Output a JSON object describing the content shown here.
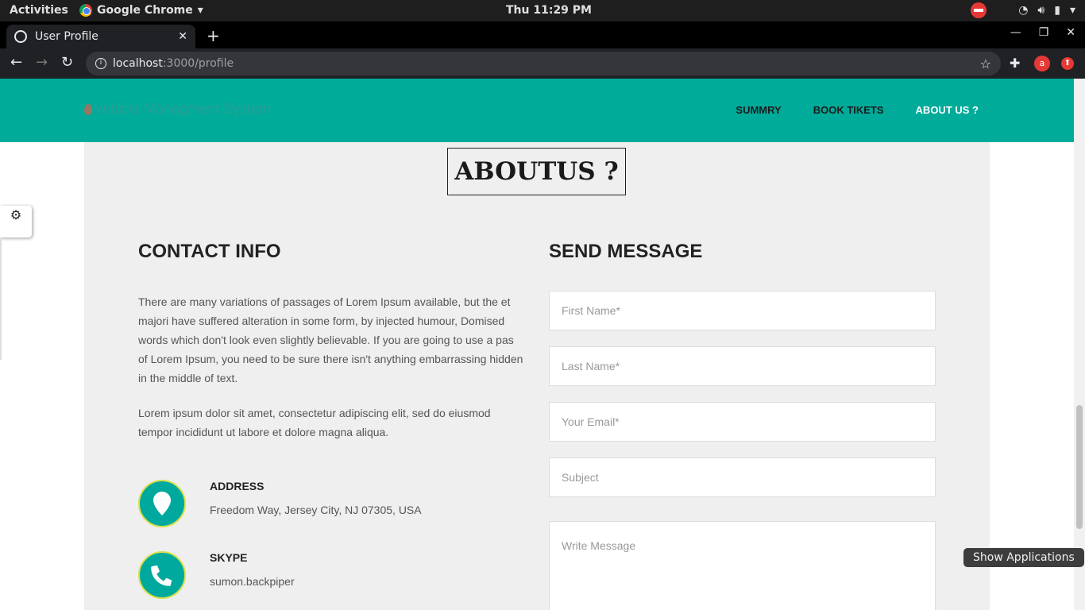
{
  "os_bar": {
    "activities": "Activities",
    "app_name": "Google Chrome",
    "clock": "Thu 11:29 PM"
  },
  "browser": {
    "tab_title": "User Profile",
    "url_host": "localhost",
    "url_path": ":3000/profile",
    "ext_avatar_letter": "a"
  },
  "navbar": {
    "brand": "Vehicle Managment System",
    "links": [
      {
        "label": "SUMMRY"
      },
      {
        "label": "BOOK TIKETS"
      },
      {
        "label": "ABOUT US ?"
      }
    ],
    "bg_color": "#00ab9a"
  },
  "about": {
    "title": "ABOUTUS ?"
  },
  "contact": {
    "heading": "CONTACT INFO",
    "paragraph1": "There are many variations of passages of Lorem Ipsum available, but the et majori have suffered alteration in some form, by injected humour, Domised words which don't look even slightly believable. If you are going to use a pas of Lorem Ipsum, you need to be sure there isn't anything embarrassing hidden in the middle of text.",
    "paragraph2": "Lorem ipsum dolor sit amet, consectetur adipiscing elit, sed do eiusmod tempor incididunt ut labore et dolore magna aliqua.",
    "items": [
      {
        "label": "ADDRESS",
        "value": "Freedom Way, Jersey City, NJ 07305, USA",
        "icon": "map-pin-icon"
      },
      {
        "label": "SKYPE",
        "value": "sumon.backpiper",
        "icon": "phone-icon"
      }
    ]
  },
  "message": {
    "heading": "SEND MESSAGE",
    "first_name_placeholder": "First Name*",
    "last_name_placeholder": "Last Name*",
    "email_placeholder": "Your Email*",
    "subject_placeholder": "Subject",
    "message_placeholder": "Write Message"
  },
  "tooltip": "Show Applications"
}
